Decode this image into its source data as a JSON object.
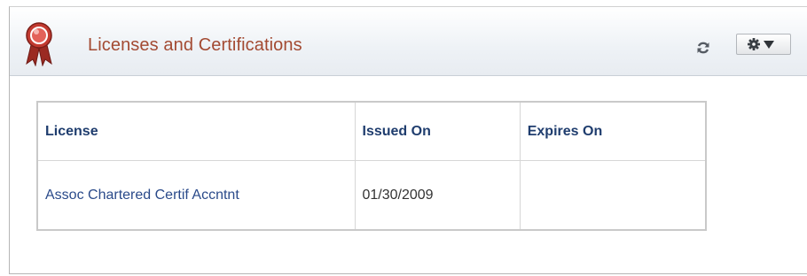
{
  "pagelet": {
    "title": "Licenses and Certifications",
    "icons": {
      "badge": "ribbon-award-icon",
      "refresh": "refresh-icon",
      "menu": "gear-icon",
      "menu_caret": "caret-down-icon"
    }
  },
  "table": {
    "columns": [
      "License",
      "Issued On",
      "Expires On"
    ],
    "rows": [
      {
        "license": "Assoc Chartered Certif Accntnt",
        "issued_on": "01/30/2009",
        "expires_on": ""
      }
    ]
  },
  "colors": {
    "title": "#a34a32",
    "header_text": "#1f3d6e",
    "link": "#2a4a8a",
    "badge_red": "#b6352c"
  }
}
